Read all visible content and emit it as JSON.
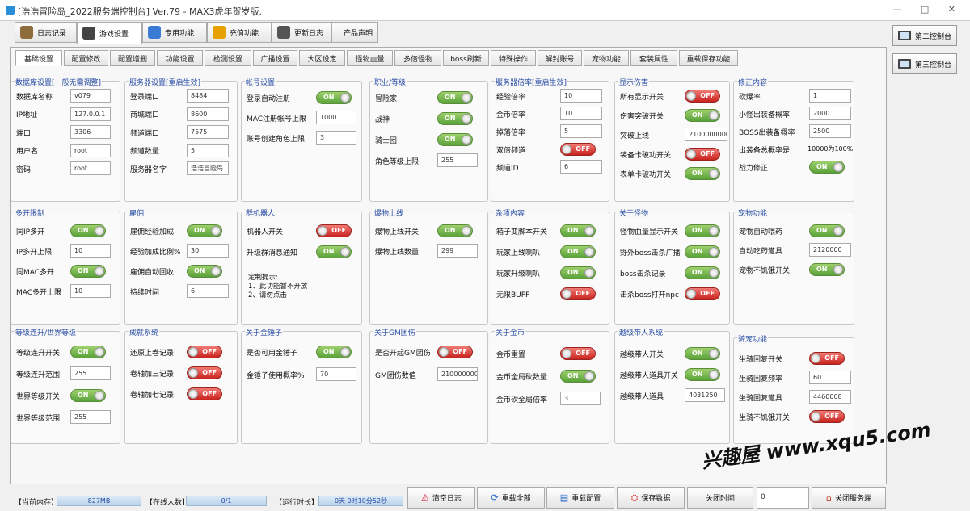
{
  "title": "[浩浩冒险岛_2022服务端控制台] Ver.79 - MAX3虎年贺岁版.",
  "window_controls": [
    "—",
    "□",
    "✕"
  ],
  "main_tabs": [
    {
      "label": "日志记录",
      "icon": "notebook-icon",
      "color": "#8f6d3a"
    },
    {
      "label": "游戏设置",
      "icon": "gamepad-icon",
      "color": "#444444"
    },
    {
      "label": "专用功能",
      "icon": "tools-icon",
      "color": "#3a7bd5"
    },
    {
      "label": "充值功能",
      "icon": "coin-icon",
      "color": "#e6a100"
    },
    {
      "label": "更新日志",
      "icon": "notebook-icon",
      "color": "#555555"
    },
    {
      "label": "产品声明",
      "icon": "",
      "color": ""
    }
  ],
  "side_buttons": [
    "第二控制台",
    "第三控制台"
  ],
  "sub_tabs": [
    "基础设置",
    "配置修改",
    "配置增删",
    "功能设置",
    "检测设置",
    "广播设置",
    "大区设定",
    "怪物血量",
    "多倍怪物",
    "boss刷新",
    "特殊操作",
    "解封账号",
    "宠物功能",
    "套装属性",
    "重载保存功能"
  ],
  "groups": {
    "db": {
      "title": "数据库设置[一般无需调整]",
      "rows": [
        {
          "label": "数据库名称",
          "value": "v079"
        },
        {
          "label": "IP地址",
          "value": "127.0.0.1"
        },
        {
          "label": "端口",
          "value": "3306"
        },
        {
          "label": "用户名",
          "value": "root"
        },
        {
          "label": "密码",
          "value": "root"
        }
      ]
    },
    "server": {
      "title": "服务器设置[重启生效]",
      "rows": [
        {
          "label": "登录端口",
          "value": "8484"
        },
        {
          "label": "商城端口",
          "value": "8600"
        },
        {
          "label": "频道端口",
          "value": "7575"
        },
        {
          "label": "频道数量",
          "value": "5"
        },
        {
          "label": "服务器名字",
          "value": "浩浩冒险岛"
        }
      ]
    },
    "account": {
      "title": "帐号设置",
      "rows": [
        {
          "label": "登录自动注册",
          "toggle": "ON"
        },
        {
          "label": "MAC注册帐号上限",
          "value": "1000"
        },
        {
          "label": "账号创建角色上限",
          "value": "3"
        }
      ]
    },
    "job": {
      "title": "职业/等级",
      "rows": [
        {
          "label": "冒险家",
          "toggle": "ON"
        },
        {
          "label": "战神",
          "toggle": "ON"
        },
        {
          "label": "骑士团",
          "toggle": "ON"
        },
        {
          "label": "角色等级上限",
          "value": "255"
        }
      ]
    },
    "rate": {
      "title": "服务器倍率[重启生效]",
      "rows": [
        {
          "label": "经验倍率",
          "value": "10"
        },
        {
          "label": "金币倍率",
          "value": "10"
        },
        {
          "label": "掉落倍率",
          "value": "5"
        },
        {
          "label": "双倍频道",
          "toggle": "OFF"
        },
        {
          "label": "频道ID",
          "value": "6"
        }
      ]
    },
    "dmg": {
      "title": "显示伤害",
      "rows": [
        {
          "label": "所有显示开关",
          "toggle": "OFF"
        },
        {
          "label": "伤害突破开关",
          "toggle": "ON"
        },
        {
          "label": "突破上线",
          "value": "2100000000"
        },
        {
          "label": "装备卡破功开关",
          "toggle": "OFF"
        },
        {
          "label": "表单卡破功开关",
          "toggle": "ON"
        }
      ]
    },
    "fix": {
      "title": "修正内容",
      "rows": [
        {
          "label": "砍爆率",
          "value": "1"
        },
        {
          "label": "小怪出装备概率",
          "value": "2000"
        },
        {
          "label": "BOSS出装备概率",
          "value": "2500"
        },
        {
          "label": "出装备总概率是",
          "text": "10000为100%"
        },
        {
          "label": "战力修正",
          "toggle": "ON"
        }
      ]
    },
    "multi": {
      "title": "多开限制",
      "rows": [
        {
          "label": "同IP多开",
          "toggle": "ON"
        },
        {
          "label": "IP多开上限",
          "value": "10"
        },
        {
          "label": "同MAC多开",
          "toggle": "ON"
        },
        {
          "label": "MAC多开上限",
          "value": "10"
        }
      ]
    },
    "hire": {
      "title": "雇佣",
      "rows": [
        {
          "label": "雇佣经验加成",
          "toggle": "ON"
        },
        {
          "label": "经验加成比例%",
          "value": "30"
        },
        {
          "label": "雇佣自动回收",
          "toggle": "ON"
        },
        {
          "label": "持续时间",
          "value": "6"
        }
      ]
    },
    "robot": {
      "title": "群机器人",
      "rows": [
        {
          "label": "机器人开关",
          "toggle": "OFF"
        },
        {
          "label": "升级群消息通知",
          "toggle": "ON"
        }
      ],
      "note": "定制提示:\n1、此功能暂不开放\n2、请勿点击"
    },
    "pet": {
      "title": "爆物上线",
      "rows": [
        {
          "label": "爆物上线开关",
          "toggle": "ON"
        },
        {
          "label": "爆物上线数量",
          "value": "299"
        }
      ]
    },
    "misc": {
      "title": "杂项内容",
      "rows": [
        {
          "label": "箱子变脚本开关",
          "toggle": "ON"
        },
        {
          "label": "玩家上线喇叭",
          "toggle": "ON"
        },
        {
          "label": "玩家升级喇叭",
          "toggle": "ON"
        },
        {
          "label": "无限BUFF",
          "toggle": "OFF"
        }
      ]
    },
    "mob": {
      "title": "关于怪物",
      "rows": [
        {
          "label": "怪物血量显示开关",
          "toggle": "ON"
        },
        {
          "label": "野外boss击杀广播",
          "toggle": "ON"
        },
        {
          "label": "boss击杀记录",
          "toggle": "ON"
        },
        {
          "label": "击杀boss打开npc",
          "toggle": "OFF"
        }
      ]
    },
    "petf": {
      "title": "宠物功能",
      "rows": [
        {
          "label": "宠物自动喂药",
          "toggle": "ON"
        },
        {
          "label": "自动吃药道具",
          "value": "2120000"
        },
        {
          "label": "宠物不饥饿开关",
          "toggle": "ON"
        }
      ]
    },
    "lvl": {
      "title": "等级连升/世界等级",
      "rows": [
        {
          "label": "等级连升开关",
          "toggle": "ON"
        },
        {
          "label": "等级连升范围",
          "value": "255"
        },
        {
          "label": "世界等级开关",
          "toggle": "ON"
        },
        {
          "label": "世界等级范围",
          "value": "255"
        }
      ]
    },
    "ach": {
      "title": "成就系统",
      "rows": [
        {
          "label": "还原上卷记录",
          "toggle": "OFF"
        },
        {
          "label": "卷轴加三记录",
          "toggle": "OFF"
        },
        {
          "label": "卷轴加七记录",
          "toggle": "OFF"
        }
      ]
    },
    "hammer": {
      "title": "关于金锤子",
      "rows": [
        {
          "label": "是否可用金锤子",
          "toggle": "ON"
        },
        {
          "label": "金锤子使用概率%",
          "value": "70"
        }
      ]
    },
    "gm": {
      "title": "关于GM团伤",
      "rows": [
        {
          "label": "是否开起GM团伤",
          "toggle": "OFF"
        },
        {
          "label": "GM团伤数值",
          "value": "2100000000"
        }
      ]
    },
    "gold": {
      "title": "关于金币",
      "rows": [
        {
          "label": "金币重置",
          "toggle": "OFF"
        },
        {
          "label": "金币全局砍数量",
          "toggle": "ON"
        },
        {
          "label": "金币砍全局倍率",
          "value": "3"
        }
      ]
    },
    "carry": {
      "title": "越级带人系统",
      "rows": [
        {
          "label": "越级带人开关",
          "toggle": "ON"
        },
        {
          "label": "越级带人道具开关",
          "toggle": "ON"
        },
        {
          "label": "越级带人道具",
          "value": "4031250"
        }
      ]
    },
    "mount": {
      "title": "骑宠功能",
      "rows": [
        {
          "label": "坐骑回复开关",
          "toggle": "OFF"
        },
        {
          "label": "坐骑回复频率",
          "value": "60"
        },
        {
          "label": "坐骑回复道具",
          "value": "4460008"
        },
        {
          "label": "坐骑不饥饿开关",
          "toggle": "OFF"
        }
      ]
    }
  },
  "status": {
    "mem_label": "【当前内存】",
    "mem_value": "827MB",
    "online_label": "【在线人数】",
    "online_value": "0/1",
    "uptime_label": "【运行时长】",
    "uptime_value": "0天 0时10分52秒"
  },
  "bottom_buttons": [
    {
      "label": "清空日志",
      "icon": "⚠",
      "color": "#d13"
    },
    {
      "label": "重载全部",
      "icon": "⟳",
      "color": "#2266cc"
    },
    {
      "label": "重载配置",
      "icon": "▤",
      "color": "#2266cc"
    },
    {
      "label": "保存数据",
      "icon": "⛭",
      "color": "#d55"
    },
    {
      "label": "关闭时间",
      "icon": "",
      "color": ""
    }
  ],
  "shutdown_input": "0",
  "shutdown_button": "关闭服务端",
  "watermark": "兴趣屋 www.xqu5.com"
}
